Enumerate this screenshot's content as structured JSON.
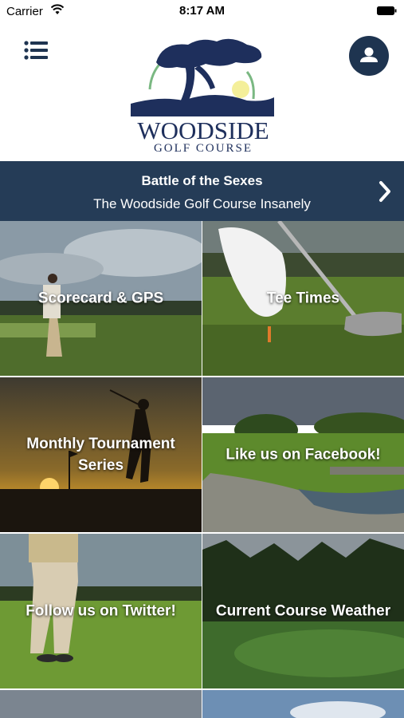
{
  "status_bar": {
    "carrier": "Carrier",
    "time": "8:17 AM"
  },
  "header": {
    "menu_icon": "hamburger-list-icon",
    "profile_icon": "user-icon",
    "logo_title": "WOODSIDE",
    "logo_subtitle": "GOLF COURSE"
  },
  "banner": {
    "title": "Battle of the Sexes",
    "subtitle": "The Woodside Golf Course Insanely",
    "arrow_icon": "chevron-right-icon"
  },
  "tiles": [
    {
      "label": "Scorecard & GPS"
    },
    {
      "label": "Tee Times"
    },
    {
      "label": "Monthly Tournament Series"
    },
    {
      "label": "Like us on Facebook!"
    },
    {
      "label": "Follow us on Twitter!"
    },
    {
      "label": "Current Course Weather"
    }
  ],
  "colors": {
    "brand_navy": "#1e3450",
    "banner_bg": "#253c57",
    "logo_text": "#1e2f5c"
  }
}
